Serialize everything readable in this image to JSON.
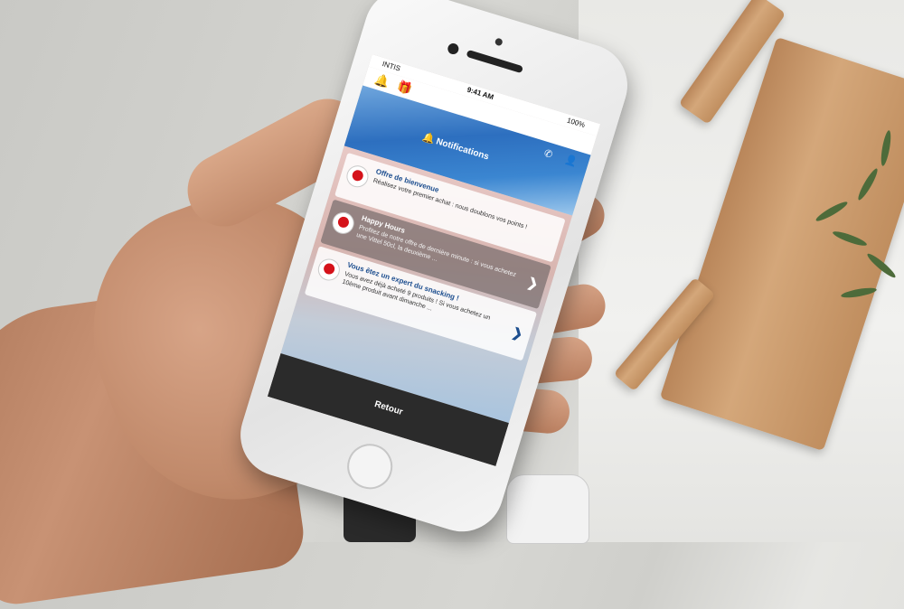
{
  "status_bar": {
    "carrier": "INTIS",
    "time": "9:41 AM",
    "battery": "100%"
  },
  "icons": [
    "bell-icon",
    "gift-icon",
    "phone-icon",
    "user-icon",
    "chevron-right-icon"
  ],
  "header": {
    "title": "Notifications"
  },
  "notifications": [
    {
      "title": "Offre de bienvenue",
      "body": "Réalisez votre premier achat : nous doublons vos points !"
    },
    {
      "title": "Happy Hours",
      "body": "Profitez de notre offre de dernière minute : si vous achetez une Vittel 50cl, la deuxième ..."
    },
    {
      "title": "Vous êtez un expert du snacking !",
      "body": "Vous avez déjà acheté 9 produits ! Si vous achetez un 10ème produit avant dimanche ..."
    }
  ],
  "footer": {
    "back_label": "Retour"
  },
  "colors": {
    "accent": "#1d4e8f",
    "brand_red": "#d5121a",
    "footer_bg": "#2b2b2b"
  }
}
